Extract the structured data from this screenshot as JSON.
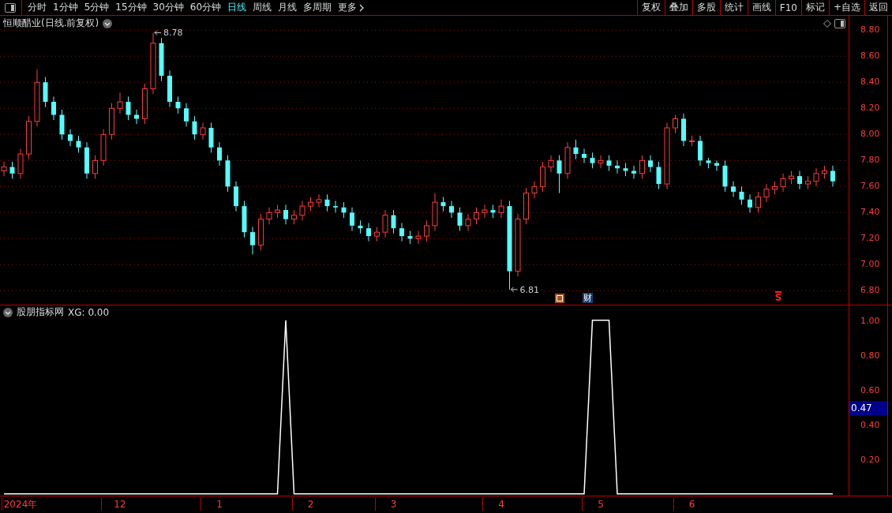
{
  "toolbar": {
    "periods": [
      {
        "label": "分时",
        "selected": false
      },
      {
        "label": "1分钟",
        "selected": false
      },
      {
        "label": "5分钟",
        "selected": false
      },
      {
        "label": "15分钟",
        "selected": false
      },
      {
        "label": "30分钟",
        "selected": false
      },
      {
        "label": "60分钟",
        "selected": false
      },
      {
        "label": "日线",
        "selected": true
      },
      {
        "label": "周线",
        "selected": false
      },
      {
        "label": "月线",
        "selected": false
      },
      {
        "label": "多周期",
        "selected": false
      }
    ],
    "more": "更多",
    "buttons": [
      "复权",
      "叠加",
      "多股",
      "统计",
      "画线",
      "F10",
      "标记",
      "+自选",
      "返回"
    ]
  },
  "price_pane": {
    "title": "恒顺醋业(日线.前复权)",
    "chart_data": {
      "type": "candlestick",
      "grid": true,
      "categories": [
        null,
        null,
        null,
        null,
        null,
        null,
        null,
        null,
        null,
        null,
        null,
        null,
        null,
        null,
        null,
        null,
        null,
        null,
        null,
        null,
        null,
        null,
        null,
        null,
        null,
        null,
        null,
        null,
        null,
        null,
        null,
        null,
        null,
        null,
        null,
        null,
        null,
        null,
        null,
        null,
        null,
        null,
        null,
        null,
        null,
        null,
        null,
        null,
        null,
        null,
        null,
        null,
        null,
        null,
        null,
        null,
        null,
        null,
        null,
        null,
        null,
        null,
        null,
        null,
        null,
        null,
        null,
        null,
        null,
        null,
        null,
        null,
        null,
        null,
        null,
        null,
        null,
        null,
        null,
        null,
        null,
        null,
        null,
        null,
        null,
        null,
        null,
        null,
        null,
        null,
        null,
        null,
        null,
        null,
        null,
        null,
        null,
        null,
        null,
        null,
        null
      ],
      "ylim": [
        6.7,
        8.91
      ],
      "yticks": [
        {
          "value": 8.8,
          "label": "8.80"
        },
        {
          "value": 8.6,
          "label": "8.60"
        },
        {
          "value": 8.4,
          "label": "8.40"
        },
        {
          "value": 8.2,
          "label": "8.20"
        },
        {
          "value": 8.0,
          "label": "8.00"
        },
        {
          "value": 7.8,
          "label": "7.80"
        },
        {
          "value": 7.6,
          "label": "7.60"
        },
        {
          "value": 7.4,
          "label": "7.40"
        },
        {
          "value": 7.2,
          "label": "7.20"
        },
        {
          "value": 7.0,
          "label": "7.00"
        },
        {
          "value": 6.8,
          "label": "6.80"
        }
      ],
      "ohlc": [
        [
          7.72,
          7.79,
          7.68,
          7.75
        ],
        [
          7.75,
          7.79,
          7.66,
          7.7
        ],
        [
          7.7,
          7.89,
          7.66,
          7.85
        ],
        [
          7.85,
          8.14,
          7.81,
          8.1
        ],
        [
          8.1,
          8.5,
          8.06,
          8.4
        ],
        [
          8.4,
          8.44,
          8.21,
          8.25
        ],
        [
          8.25,
          8.29,
          8.11,
          8.15
        ],
        [
          8.15,
          8.19,
          7.96,
          8.0
        ],
        [
          8.0,
          8.04,
          7.91,
          7.95
        ],
        [
          7.95,
          7.99,
          7.86,
          7.9
        ],
        [
          7.9,
          7.94,
          7.66,
          7.7
        ],
        [
          7.7,
          7.84,
          7.66,
          7.8
        ],
        [
          7.8,
          8.04,
          7.76,
          8.0
        ],
        [
          8.0,
          8.24,
          7.96,
          8.2
        ],
        [
          8.2,
          8.32,
          8.16,
          8.25
        ],
        [
          8.25,
          8.29,
          8.11,
          8.15
        ],
        [
          8.15,
          8.19,
          8.08,
          8.12
        ],
        [
          8.12,
          8.39,
          8.08,
          8.35
        ],
        [
          8.35,
          8.78,
          8.31,
          8.7
        ],
        [
          8.7,
          8.74,
          8.41,
          8.45
        ],
        [
          8.45,
          8.49,
          8.21,
          8.25
        ],
        [
          8.25,
          8.29,
          8.16,
          8.2
        ],
        [
          8.2,
          8.24,
          8.06,
          8.1
        ],
        [
          8.1,
          8.14,
          7.96,
          8.0
        ],
        [
          8.0,
          8.09,
          7.96,
          8.05
        ],
        [
          8.05,
          8.09,
          7.86,
          7.9
        ],
        [
          7.9,
          7.94,
          7.76,
          7.8
        ],
        [
          7.8,
          7.84,
          7.56,
          7.6
        ],
        [
          7.6,
          7.64,
          7.41,
          7.45
        ],
        [
          7.45,
          7.49,
          7.21,
          7.25
        ],
        [
          7.25,
          7.29,
          7.08,
          7.15
        ],
        [
          7.15,
          7.39,
          7.11,
          7.35
        ],
        [
          7.35,
          7.44,
          7.31,
          7.4
        ],
        [
          7.4,
          7.46,
          7.36,
          7.42
        ],
        [
          7.42,
          7.46,
          7.31,
          7.35
        ],
        [
          7.35,
          7.42,
          7.31,
          7.38
        ],
        [
          7.38,
          7.49,
          7.34,
          7.45
        ],
        [
          7.45,
          7.52,
          7.41,
          7.48
        ],
        [
          7.48,
          7.54,
          7.44,
          7.5
        ],
        [
          7.5,
          7.54,
          7.41,
          7.45
        ],
        [
          7.45,
          7.49,
          7.4,
          7.44
        ],
        [
          7.44,
          7.48,
          7.36,
          7.4
        ],
        [
          7.4,
          7.44,
          7.26,
          7.3
        ],
        [
          7.3,
          7.34,
          7.24,
          7.28
        ],
        [
          7.28,
          7.32,
          7.18,
          7.22
        ],
        [
          7.22,
          7.29,
          7.18,
          7.25
        ],
        [
          7.25,
          7.42,
          7.21,
          7.38
        ],
        [
          7.38,
          7.42,
          7.24,
          7.28
        ],
        [
          7.28,
          7.32,
          7.18,
          7.22
        ],
        [
          7.22,
          7.26,
          7.16,
          7.2
        ],
        [
          7.2,
          7.26,
          7.16,
          7.22
        ],
        [
          7.22,
          7.34,
          7.18,
          7.3
        ],
        [
          7.3,
          7.55,
          7.26,
          7.48
        ],
        [
          7.48,
          7.52,
          7.41,
          7.45
        ],
        [
          7.45,
          7.49,
          7.36,
          7.4
        ],
        [
          7.4,
          7.44,
          7.26,
          7.3
        ],
        [
          7.3,
          7.39,
          7.26,
          7.35
        ],
        [
          7.35,
          7.44,
          7.31,
          7.4
        ],
        [
          7.4,
          7.46,
          7.36,
          7.42
        ],
        [
          7.42,
          7.46,
          7.36,
          7.4
        ],
        [
          7.4,
          7.5,
          7.36,
          7.45
        ],
        [
          7.45,
          7.49,
          6.81,
          6.95
        ],
        [
          6.95,
          7.39,
          6.91,
          7.35
        ],
        [
          7.35,
          7.59,
          7.31,
          7.55
        ],
        [
          7.55,
          7.64,
          7.51,
          7.6
        ],
        [
          7.6,
          7.79,
          7.56,
          7.75
        ],
        [
          7.75,
          7.84,
          7.71,
          7.8
        ],
        [
          7.8,
          7.84,
          7.55,
          7.7
        ],
        [
          7.7,
          7.94,
          7.66,
          7.9
        ],
        [
          7.9,
          7.96,
          7.81,
          7.85
        ],
        [
          7.85,
          7.89,
          7.78,
          7.82
        ],
        [
          7.82,
          7.86,
          7.74,
          7.78
        ],
        [
          7.78,
          7.84,
          7.74,
          7.8
        ],
        [
          7.8,
          7.84,
          7.72,
          7.76
        ],
        [
          7.76,
          7.8,
          7.7,
          7.74
        ],
        [
          7.74,
          7.78,
          7.68,
          7.72
        ],
        [
          7.72,
          7.76,
          7.66,
          7.7
        ],
        [
          7.7,
          7.84,
          7.66,
          7.8
        ],
        [
          7.8,
          7.84,
          7.71,
          7.75
        ],
        [
          7.75,
          7.79,
          7.58,
          7.62
        ],
        [
          7.62,
          8.09,
          7.58,
          8.05
        ],
        [
          8.05,
          8.15,
          8.01,
          8.12
        ],
        [
          8.12,
          8.16,
          7.91,
          7.95
        ],
        [
          7.95,
          7.99,
          7.91,
          7.95
        ],
        [
          7.95,
          7.99,
          7.76,
          7.8
        ],
        [
          7.8,
          7.82,
          7.74,
          7.78
        ],
        [
          7.78,
          7.8,
          7.72,
          7.76
        ],
        [
          7.76,
          7.8,
          7.56,
          7.6
        ],
        [
          7.6,
          7.64,
          7.52,
          7.56
        ],
        [
          7.56,
          7.6,
          7.46,
          7.5
        ],
        [
          7.5,
          7.54,
          7.4,
          7.44
        ],
        [
          7.44,
          7.56,
          7.4,
          7.52
        ],
        [
          7.52,
          7.62,
          7.48,
          7.58
        ],
        [
          7.58,
          7.64,
          7.54,
          7.6
        ],
        [
          7.6,
          7.7,
          7.56,
          7.66
        ],
        [
          7.66,
          7.72,
          7.62,
          7.68
        ],
        [
          7.68,
          7.72,
          7.58,
          7.62
        ],
        [
          7.62,
          7.68,
          7.58,
          7.64
        ],
        [
          7.64,
          7.74,
          7.6,
          7.7
        ],
        [
          7.7,
          7.76,
          7.66,
          7.72
        ],
        [
          7.72,
          7.76,
          7.6,
          7.64
        ]
      ],
      "annotations": [
        "8.78",
        "6.81"
      ]
    },
    "events": [
      {
        "kind": "box"
      },
      {
        "kind": "text",
        "label": "财"
      },
      {
        "kind": "signal",
        "label": "S"
      }
    ]
  },
  "indicator_pane": {
    "title": "股朋指标网",
    "reading": "XG: 0.00",
    "cursor_label": "0.47",
    "chart_data": {
      "type": "line",
      "categories": [
        null,
        null,
        "2024年",
        null,
        null,
        null,
        null,
        null,
        null,
        null,
        null,
        null,
        null,
        null,
        "12",
        null,
        null,
        null,
        null,
        null,
        null,
        null,
        null,
        null,
        null,
        null,
        "1",
        null,
        null,
        null,
        null,
        null,
        null,
        null,
        null,
        null,
        null,
        "2",
        null,
        null,
        null,
        null,
        null,
        null,
        null,
        null,
        null,
        "3",
        null,
        null,
        null,
        null,
        null,
        null,
        null,
        null,
        null,
        null,
        null,
        null,
        "4",
        null,
        null,
        null,
        null,
        null,
        null,
        null,
        null,
        null,
        null,
        null,
        "5",
        null,
        null,
        null,
        null,
        null,
        null,
        null,
        null,
        null,
        null,
        "6",
        null,
        null,
        null,
        null,
        null,
        null,
        null,
        null,
        null,
        null,
        null,
        null,
        null,
        null,
        null,
        null,
        null
      ],
      "ylim": [
        -0.01,
        1.09
      ],
      "yticks": [
        {
          "value": 1.0,
          "label": "1.00"
        },
        {
          "value": 0.8,
          "label": "0.80"
        },
        {
          "value": 0.6,
          "label": "0.60"
        },
        {
          "value": 0.4,
          "label": "0.40"
        },
        {
          "value": 0.2,
          "label": "0.20"
        }
      ],
      "series": [
        {
          "color": "#ffffff",
          "values": [
            0,
            0,
            0,
            0,
            0,
            0,
            0,
            0,
            0,
            0,
            0,
            0,
            0,
            0,
            0,
            0,
            0,
            0,
            0,
            0,
            0,
            0,
            0,
            0,
            0,
            0,
            0,
            0,
            0,
            0,
            0,
            0,
            0,
            0,
            1,
            0,
            0,
            0,
            0,
            0,
            0,
            0,
            0,
            0,
            0,
            0,
            0,
            0,
            0,
            0,
            0,
            0,
            0,
            0,
            0,
            0,
            0,
            0,
            0,
            0,
            0,
            0,
            0,
            0,
            0,
            0,
            0,
            0,
            0,
            0,
            0,
            1,
            1,
            1,
            0,
            0,
            0,
            0,
            0,
            0,
            0,
            0,
            0,
            0,
            0,
            0,
            0,
            0,
            0,
            0,
            0,
            0,
            0,
            0,
            0,
            0,
            0,
            0,
            0,
            0,
            0
          ]
        }
      ]
    }
  }
}
